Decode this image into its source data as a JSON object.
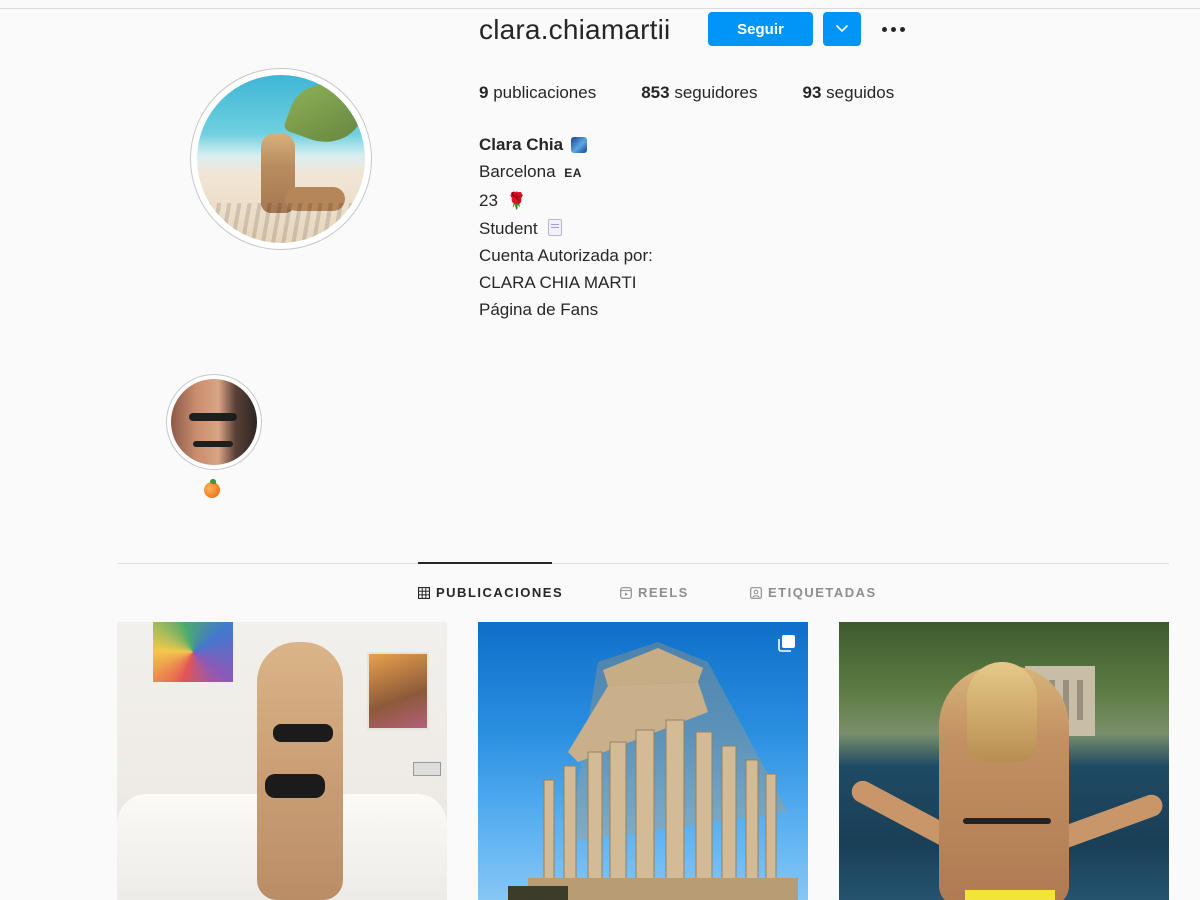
{
  "profile": {
    "username": "clara.chiamartii",
    "follow_label": "Seguir",
    "stats": [
      {
        "count": "9",
        "label": "publicaciones"
      },
      {
        "count": "853",
        "label": "seguidores"
      },
      {
        "count": "93",
        "label": "seguidos"
      }
    ],
    "bio": {
      "name": "Clara Chia",
      "line1": "Barcelona",
      "line1_badge": "EA",
      "line2": "23",
      "line3": "Student",
      "line4": "Cuenta Autorizada por:",
      "line5": "CLARA CHIA MARTI",
      "line6": "Página de Fans"
    }
  },
  "highlights": [
    {
      "icon": "peach-emoji"
    }
  ],
  "tabs": [
    {
      "label": "PUBLICACIONES",
      "icon": "grid-icon",
      "active": true
    },
    {
      "label": "REELS",
      "icon": "reels-icon",
      "active": false
    },
    {
      "label": "ETIQUETADAS",
      "icon": "tagged-icon",
      "active": false
    }
  ],
  "posts": [
    {
      "type": "image"
    },
    {
      "type": "carousel",
      "icon": "multiple-images-icon"
    },
    {
      "type": "image"
    }
  ],
  "colors": {
    "accent": "#0095f6",
    "background": "#fafafa",
    "text": "#262626",
    "muted": "#8e8e8e",
    "border": "#dbdbdb"
  }
}
